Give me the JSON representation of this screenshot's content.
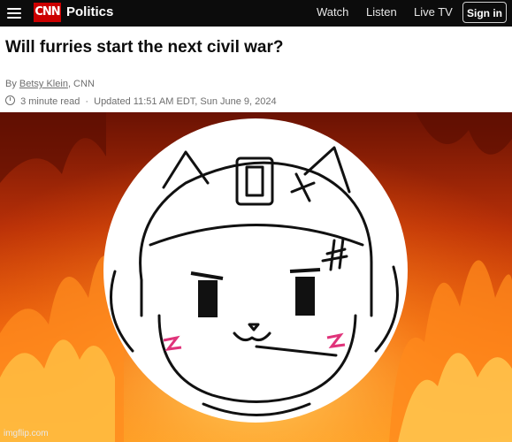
{
  "header": {
    "logo": "CNN",
    "section": "Politics",
    "nav": [
      "Watch",
      "Listen",
      "Live TV"
    ],
    "sign_in": "Sign in"
  },
  "article": {
    "headline": "Will furries start the next civil war?",
    "by_prefix": "By",
    "author": "Betsy Klein",
    "by_suffix": ", CNN",
    "read_time": "3 minute read",
    "separator": "·",
    "updated": "Updated 11:51 AM EDT, Sun June 9, 2024"
  },
  "image": {
    "description_icon": "fire-background",
    "watermark": "imgflip.com"
  },
  "colors": {
    "topbar": "#0c0c0c",
    "brand": "#cc0000"
  }
}
